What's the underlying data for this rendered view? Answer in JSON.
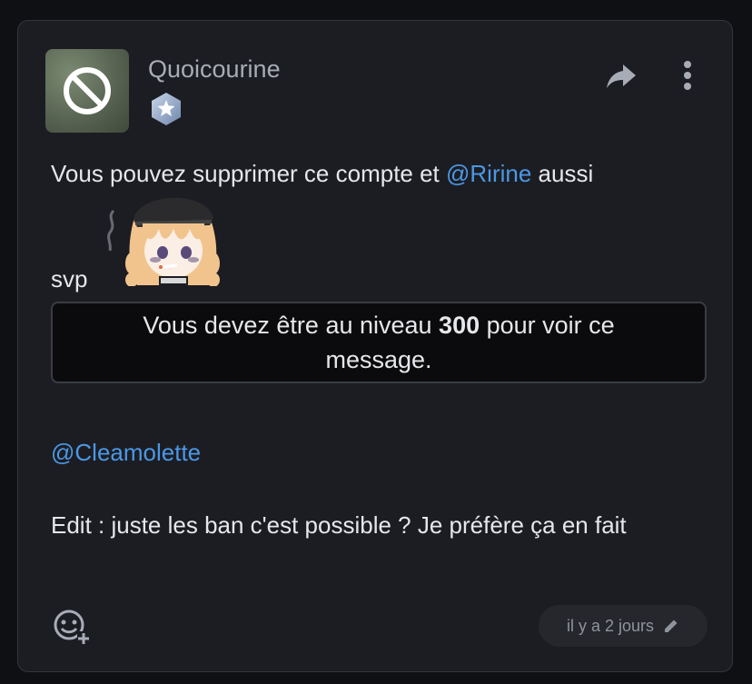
{
  "post": {
    "username": "Quoicourine",
    "rank_badge_icon": "star-shield-icon",
    "avatar_icon": "banned-circle-icon",
    "actions": {
      "share_icon": "share-arrow-icon",
      "menu_icon": "vertical-dots-icon"
    },
    "body": {
      "line1_prefix": "Vous pouvez supprimer ce compte et ",
      "mention1": "@Ririne",
      "line1_suffix": " aussi",
      "line2": "svp",
      "sticker_icon": "anime-girl-sticker",
      "locked_prefix": "Vous devez être au niveau ",
      "locked_level": "300",
      "locked_suffix": " pour voir ce message.",
      "mention2": "@Cleamolette",
      "edit_text": "Edit : juste les ban c'est possible ? Je préfère ça en fait"
    },
    "footer": {
      "reaction_icon": "add-reaction-icon",
      "timestamp": "il y a 2 jours",
      "edit_icon": "pencil-icon"
    }
  },
  "colors": {
    "background": "#0f1013",
    "card": "#1c1d22",
    "mention": "#4b98e6",
    "text": "#e6e7ea",
    "muted": "#a8acb6"
  }
}
